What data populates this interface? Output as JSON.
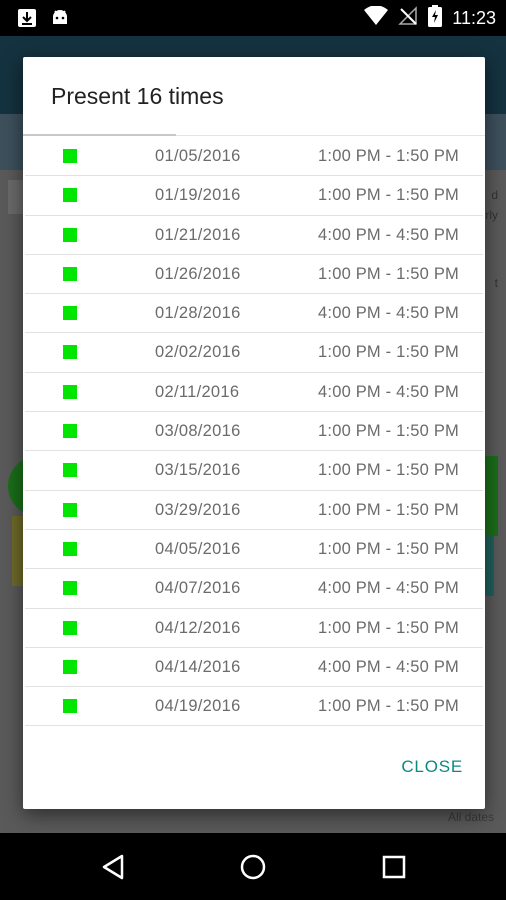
{
  "status_bar": {
    "time": "11:23",
    "icons": [
      "download-icon",
      "android-icon",
      "wifi-icon",
      "no-signal-icon",
      "battery-charging-icon"
    ]
  },
  "background": {
    "side_text_1": "d",
    "side_text_2": "rly",
    "side_text_3": "t",
    "footer_text": "All dates"
  },
  "dialog": {
    "title": "Present 16 times",
    "close_label": "CLOSE",
    "marker_color": "#00e600",
    "rows": [
      {
        "date": "01/05/2016",
        "time": "1:00 PM - 1:50 PM"
      },
      {
        "date": "01/19/2016",
        "time": "1:00 PM - 1:50 PM"
      },
      {
        "date": "01/21/2016",
        "time": "4:00 PM - 4:50 PM"
      },
      {
        "date": "01/26/2016",
        "time": "1:00 PM - 1:50 PM"
      },
      {
        "date": "01/28/2016",
        "time": "4:00 PM - 4:50 PM"
      },
      {
        "date": "02/02/2016",
        "time": "1:00 PM - 1:50 PM"
      },
      {
        "date": "02/11/2016",
        "time": "4:00 PM - 4:50 PM"
      },
      {
        "date": "03/08/2016",
        "time": "1:00 PM - 1:50 PM"
      },
      {
        "date": "03/15/2016",
        "time": "1:00 PM - 1:50 PM"
      },
      {
        "date": "03/29/2016",
        "time": "1:00 PM - 1:50 PM"
      },
      {
        "date": "04/05/2016",
        "time": "1:00 PM - 1:50 PM"
      },
      {
        "date": "04/07/2016",
        "time": "4:00 PM - 4:50 PM"
      },
      {
        "date": "04/12/2016",
        "time": "1:00 PM - 1:50 PM"
      },
      {
        "date": "04/14/2016",
        "time": "4:00 PM - 4:50 PM"
      },
      {
        "date": "04/19/2016",
        "time": "1:00 PM - 1:50 PM"
      }
    ]
  },
  "nav_bar": {
    "icons": [
      "back-icon",
      "home-icon",
      "recents-icon"
    ]
  }
}
